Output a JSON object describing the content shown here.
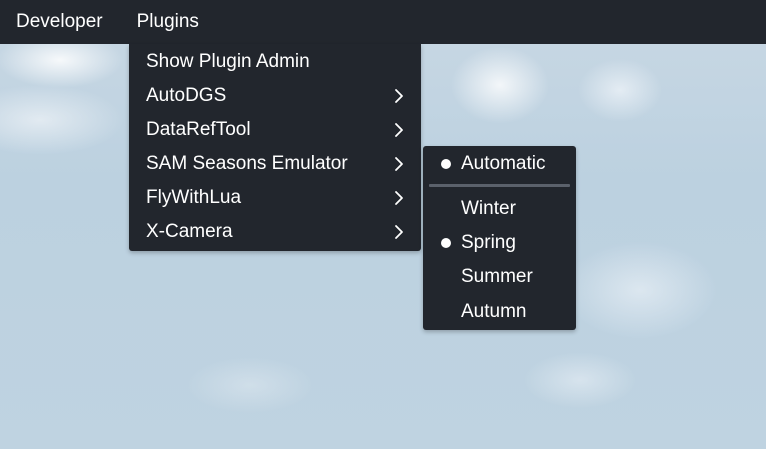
{
  "menubar": {
    "items": [
      "Developer",
      "Plugins"
    ]
  },
  "plugins_menu": {
    "items": [
      {
        "label": "Show Plugin Admin",
        "submenu": false
      },
      {
        "label": "AutoDGS",
        "submenu": true
      },
      {
        "label": "DataRefTool",
        "submenu": true
      },
      {
        "label": "SAM Seasons Emulator",
        "submenu": true
      },
      {
        "label": "FlyWithLua",
        "submenu": true
      },
      {
        "label": "X-Camera",
        "submenu": true
      }
    ]
  },
  "seasons_menu": {
    "items": [
      {
        "label": "Automatic",
        "checked": true
      },
      {
        "label": "Winter",
        "checked": false
      },
      {
        "label": "Spring",
        "checked": true
      },
      {
        "label": "Summer",
        "checked": false
      },
      {
        "label": "Autumn",
        "checked": false
      }
    ]
  },
  "icons": {
    "submenu_arrow": "chevron-right-icon",
    "checked_marker": "radio-dot-icon"
  },
  "colors": {
    "menu_background": "#22262d",
    "text": "#ffffff",
    "divider": "#5b616b"
  }
}
